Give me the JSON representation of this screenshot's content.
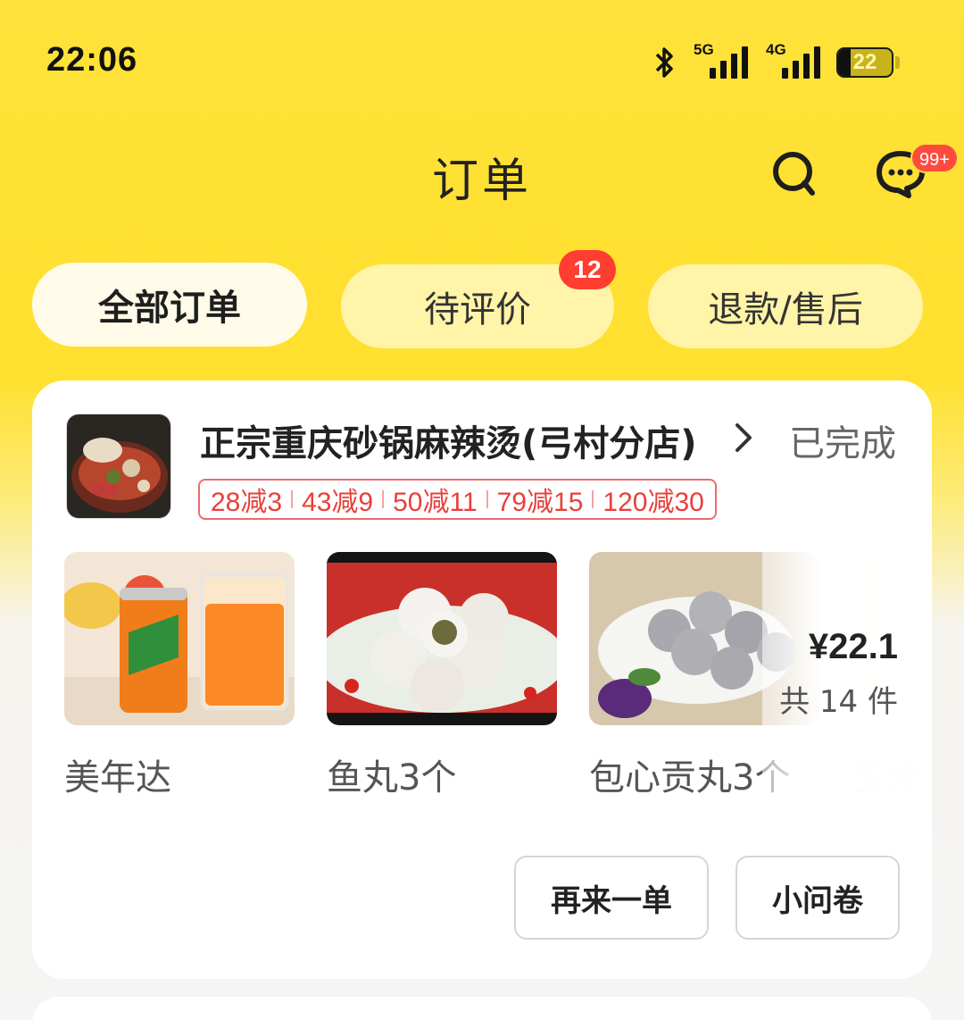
{
  "status_bar": {
    "time": "22:06",
    "network_1": "5G",
    "network_2": "4G",
    "battery": "22",
    "icons": [
      "bluetooth-icon",
      "signal-icon",
      "battery-icon"
    ]
  },
  "header": {
    "title": "订单",
    "message_badge": "99+",
    "icons": [
      "search-icon",
      "message-icon"
    ]
  },
  "tabs": [
    {
      "label": "全部订单",
      "active": true
    },
    {
      "label": "待评价",
      "badge": "12"
    },
    {
      "label": "退款/售后"
    }
  ],
  "order": {
    "shop_name": "正宗重庆砂锅麻辣烫(弓村分店)",
    "status": "已完成",
    "promos": [
      "28减3",
      "43减9",
      "50减11",
      "79减15",
      "120减30"
    ],
    "items": [
      {
        "name": "美年达"
      },
      {
        "name": "鱼丸3个"
      },
      {
        "name": "包心贡丸3个"
      },
      {
        "name": "玉米"
      }
    ],
    "price": "¥22.1",
    "count": "共 14 件",
    "actions": {
      "reorder": "再来一单",
      "survey": "小问卷"
    }
  },
  "colors": {
    "accent": "#ffe23a",
    "badge": "#ff3d30",
    "promo": "#e8403a"
  }
}
